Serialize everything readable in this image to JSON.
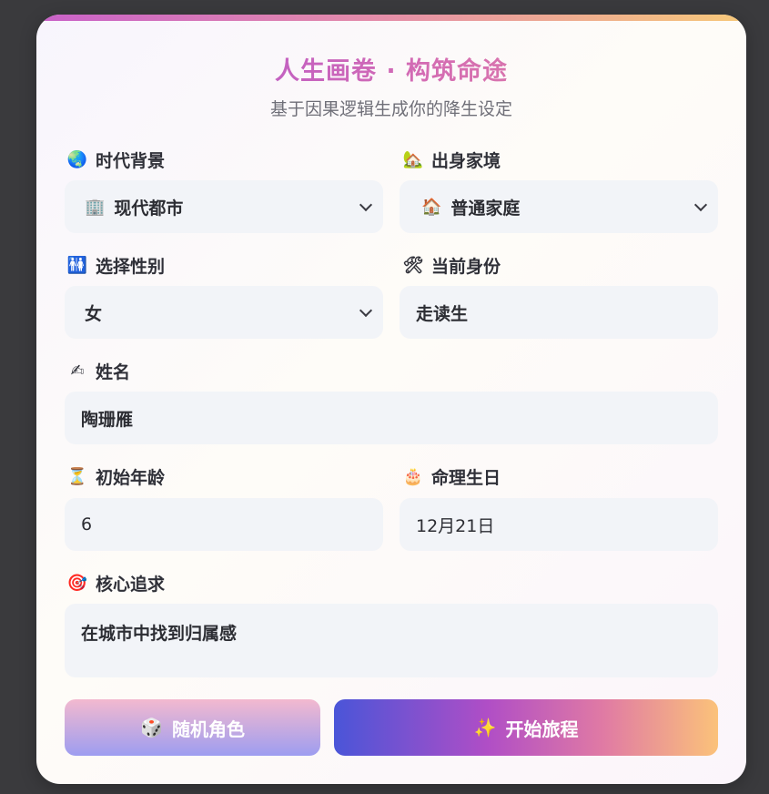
{
  "header": {
    "title": "人生画卷 · 构筑命途",
    "subtitle": "基于因果逻辑生成你的降生设定"
  },
  "form": {
    "era": {
      "icon": "🌏",
      "icon_name": "globe-icon",
      "label": "时代背景",
      "value_icon": "🏢",
      "value": "现代都市"
    },
    "family": {
      "icon": "🏡",
      "icon_name": "house-garden-icon",
      "label": "出身家境",
      "value_icon": "🏠",
      "value": "普通家庭"
    },
    "gender": {
      "icon": "🚻",
      "icon_name": "restroom-icon",
      "label": "选择性别",
      "value": "女"
    },
    "identity": {
      "icon": "🛠",
      "icon_name": "tools-icon",
      "label": "当前身份",
      "value": "走读生"
    },
    "name": {
      "icon": "✍",
      "icon_name": "writing-hand-icon",
      "label": "姓名",
      "value": "陶珊雁"
    },
    "age": {
      "icon": "⏳",
      "icon_name": "hourglass-icon",
      "label": "初始年龄",
      "value": "6"
    },
    "birthday": {
      "icon": "🎂",
      "icon_name": "birthday-cake-icon",
      "label": "命理生日",
      "value": "12月21日"
    },
    "pursuit": {
      "icon": "🎯",
      "icon_name": "target-icon",
      "label": "核心追求",
      "value": "在城市中找到归属感"
    }
  },
  "actions": {
    "random": {
      "icon": "🎲",
      "icon_name": "dice-icon",
      "label": "随机角色"
    },
    "start": {
      "icon": "✨",
      "icon_name": "sparkles-icon",
      "label": "开始旅程"
    }
  }
}
